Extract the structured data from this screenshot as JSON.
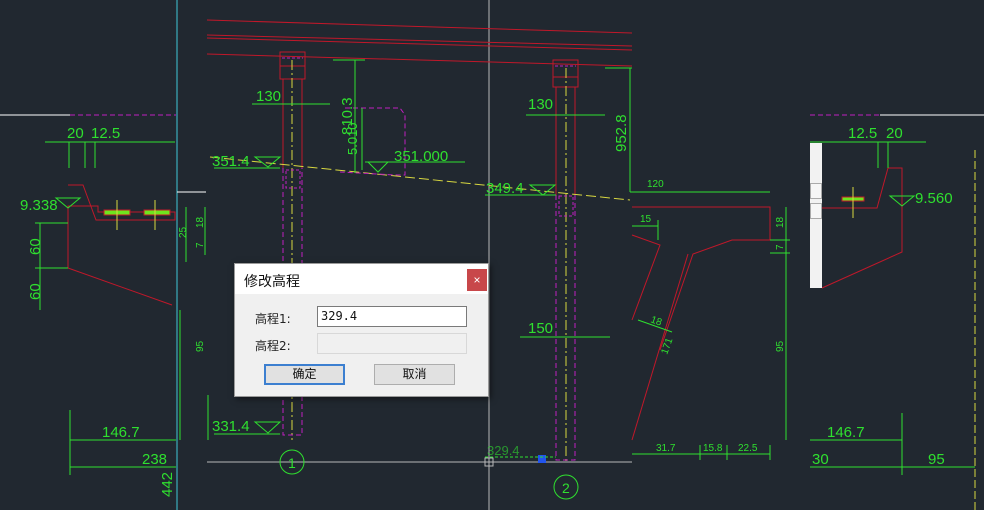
{
  "dialog": {
    "title": "修改高程",
    "close_label": "×",
    "elevation1_label": "高程1:",
    "elevation1_value": "329.4",
    "elevation2_label": "高程2:",
    "elevation2_value": "",
    "ok_label": "确定",
    "cancel_label": "取消"
  },
  "drawing": {
    "dims": {
      "left_20": "20",
      "left_12_5": "12.5",
      "left_9_338": "9.338",
      "left_60a": "60",
      "left_60b": "60",
      "left_25": "25",
      "left_18": "18",
      "left_7": "7",
      "left_95": "95",
      "left_146_7": "146.7",
      "left_238": "238",
      "left_442": "442",
      "pier1_130": "130",
      "pier2_130": "130",
      "elev_351_4": "351.4",
      "elev_349_4": "349.4",
      "elev_351_000": "351.000",
      "dim_810_3": "810.3",
      "dim_5_010": "5.010",
      "dim_952_8": "952.8",
      "elev_331_4": "331.4",
      "elev_329_4": "329.4",
      "dim_150": "150",
      "right_120": "120",
      "right_15": "15",
      "right_18_slant": "18",
      "right_171": "171",
      "right_18": "18",
      "right_7": "7",
      "right_95": "95",
      "right_31_7": "31.7",
      "right_15_8": "15.8",
      "right_22_5": "22.5",
      "right_146_7": "146.7",
      "right_30": "30",
      "right_95b": "95",
      "right_12_5": "12.5",
      "right_20": "20",
      "right_9_560": "9.560"
    },
    "axis_labels": {
      "axis1": "1",
      "axis2": "2"
    },
    "colors": {
      "background": "#212830",
      "dimension": "#2fe02f",
      "structure": "#c0182a",
      "hidden": "#c020c0",
      "center": "#d8d840"
    }
  }
}
